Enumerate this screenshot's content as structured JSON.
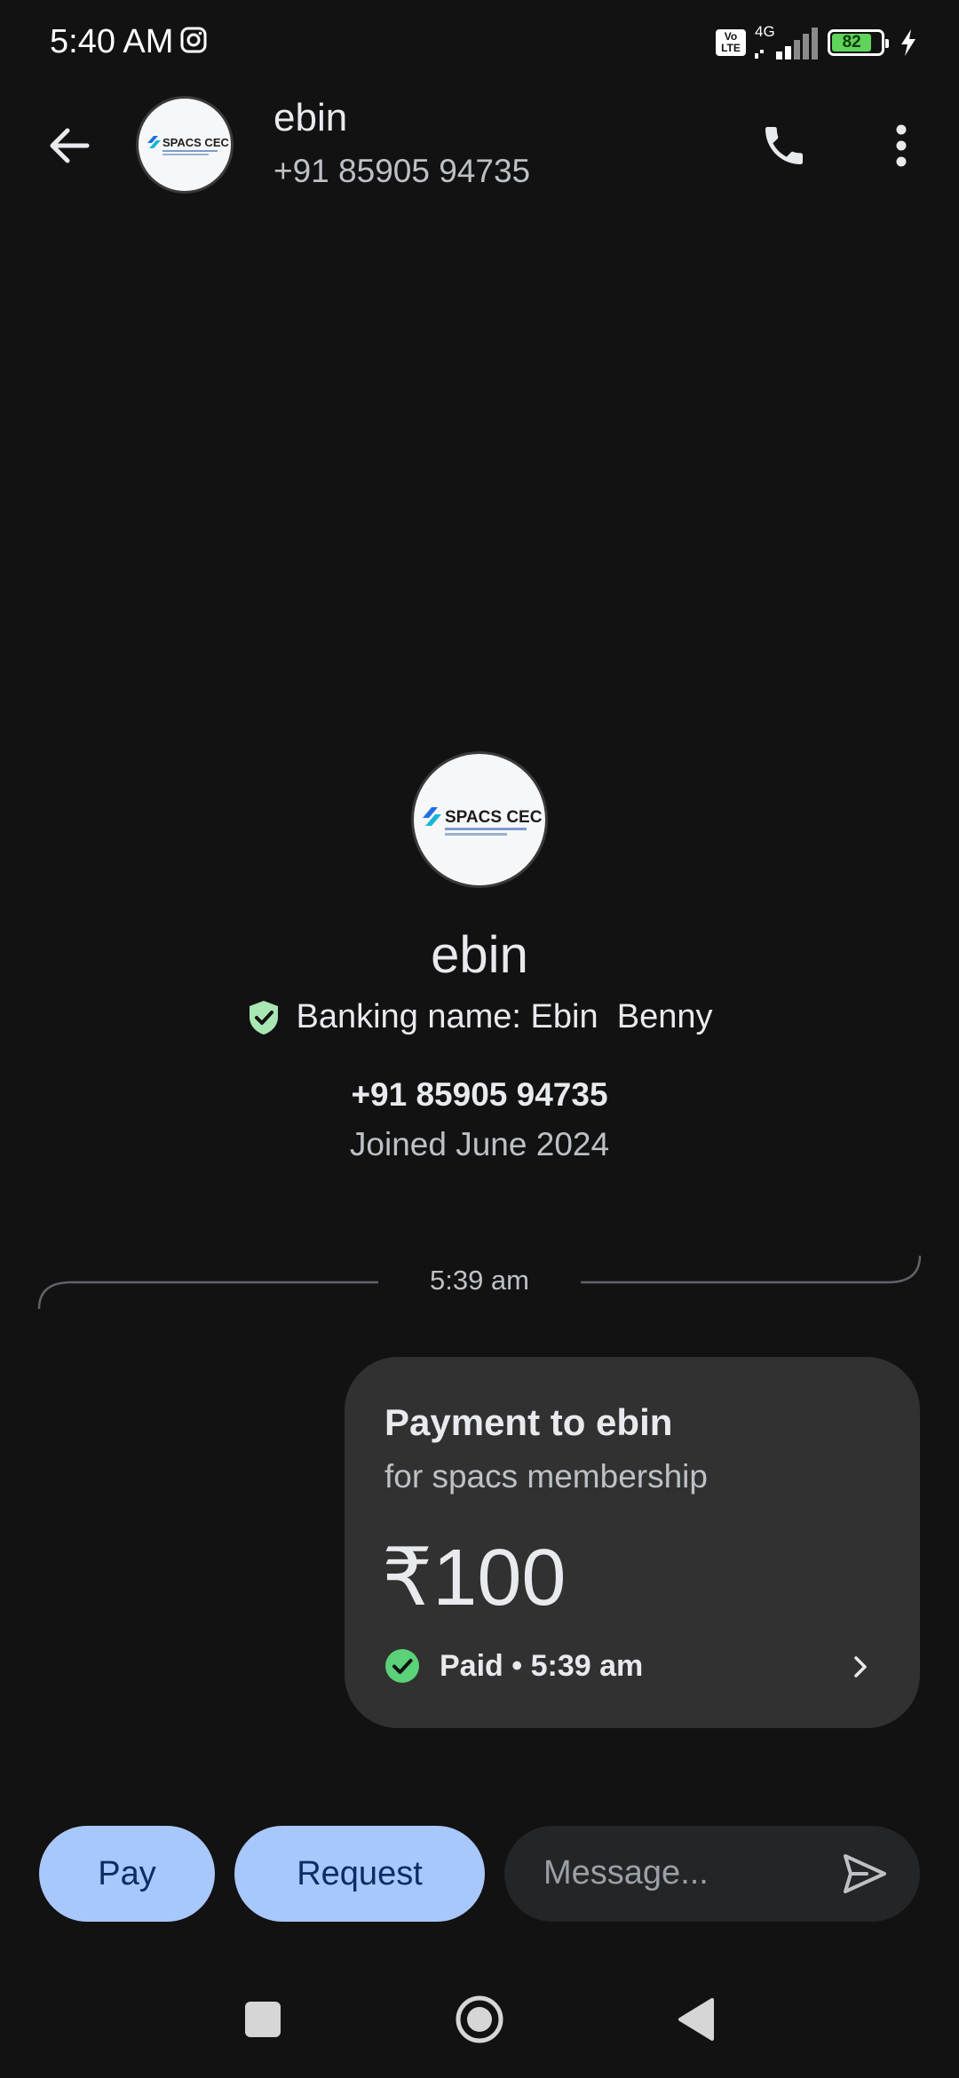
{
  "status_bar": {
    "time": "5:40 AM",
    "network": "4G",
    "battery": "82",
    "volte": "Vo LTE"
  },
  "header": {
    "contact_name": "ebin",
    "contact_phone": "+91 85905 94735",
    "avatar_logo": "SPACS CEC",
    "icons": [
      "back-arrow-icon",
      "phone-icon",
      "more-vert-icon"
    ]
  },
  "profile": {
    "name": "ebin",
    "banking_name": "Banking name: Ebin  Benny",
    "phone": "+91 85905 94735",
    "joined": "Joined June 2024"
  },
  "conversation": {
    "timestamp": "5:39 am",
    "payment": {
      "title": "Payment to ebin",
      "note": "for spacs membership",
      "amount": "₹100",
      "status": "Paid • 5:39 am"
    }
  },
  "composer": {
    "pay_label": "Pay",
    "request_label": "Request",
    "message_placeholder": "Message..."
  },
  "colors": {
    "background": "#121212",
    "card": "#313131",
    "button": "#a8c7fa",
    "button_text": "#0b2c66",
    "verified": "#a8e6b4",
    "paid": "#5bd178",
    "battery": "#5fd35a"
  }
}
